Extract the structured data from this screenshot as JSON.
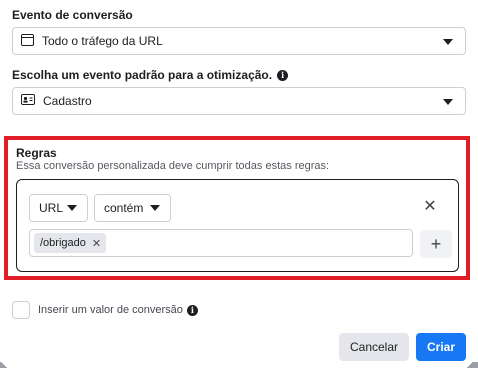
{
  "conversion_event": {
    "label": "Evento de conversão",
    "value": "Todo o tráfego da URL",
    "icon": "browser-window-icon"
  },
  "standard_event": {
    "label": "Escolha um evento padrão para a otimização.",
    "value": "Cadastro",
    "icon": "id-card-icon"
  },
  "rules": {
    "title": "Regras",
    "description": "Essa conversão personalizada deve cumprir todas estas regras:",
    "field": "URL",
    "operator": "contém",
    "tags": [
      "/obrigado"
    ],
    "highlight_color": "#e11d2a"
  },
  "conversion_value": {
    "label": "Inserir um valor de conversão",
    "checked": false
  },
  "footer": {
    "cancel_label": "Cancelar",
    "create_label": "Criar",
    "create_color": "#1877f2"
  }
}
